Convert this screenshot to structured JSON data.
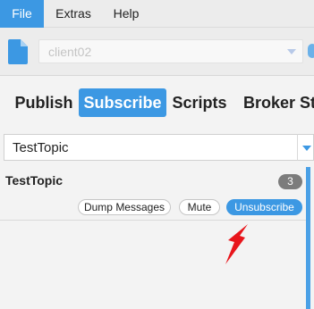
{
  "menubar": {
    "items": [
      {
        "label": "File",
        "active": true
      },
      {
        "label": "Extras"
      },
      {
        "label": "Help"
      }
    ]
  },
  "connection": {
    "file_icon": "document-icon",
    "selected": "client02"
  },
  "tabs": [
    {
      "label": "Publish"
    },
    {
      "label": "Subscribe",
      "active": true
    },
    {
      "label": "Scripts"
    },
    {
      "label": "Broker Sta"
    }
  ],
  "subscribe": {
    "topic_value": "TestTopic"
  },
  "subscriptions": [
    {
      "topic": "TestTopic",
      "count": "3",
      "buttons": {
        "dump": "Dump Messages",
        "mute": "Mute",
        "unsubscribe": "Unsubscribe"
      }
    }
  ],
  "colors": {
    "accent": "#3c98e3",
    "arrow": "#e8151b",
    "badge": "#7c7c7c"
  }
}
